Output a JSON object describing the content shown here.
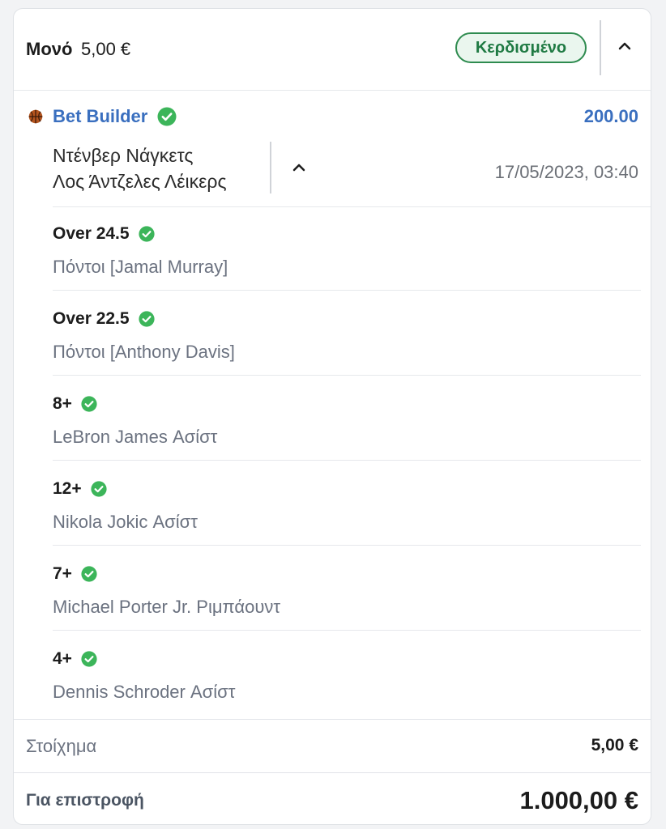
{
  "header": {
    "bet_type": "Μονό",
    "stake": "5,00 €",
    "status": "Κερδισμένο"
  },
  "selection": {
    "title": "Bet Builder",
    "odds": "200.00",
    "team_home": "Ντένβερ Νάγκετς",
    "team_away": "Λος Άντζελες  Λέικερς",
    "date": "17/05/2023, 03:40",
    "sport_icon": "basketball-icon"
  },
  "legs": [
    {
      "line": "Over 24.5",
      "market": "Πόντοι [Jamal Murray]"
    },
    {
      "line": "Over 22.5",
      "market": "Πόντοι [Anthony Davis]"
    },
    {
      "line": "8+",
      "market": "LeBron James Ασίστ"
    },
    {
      "line": "12+",
      "market": "Nikola Jokic Ασίστ"
    },
    {
      "line": "7+",
      "market": "Michael Porter Jr. Ριμπάουντ"
    },
    {
      "line": "4+",
      "market": "Dennis Schroder Ασίστ"
    }
  ],
  "footer": {
    "stake_label": "Στοίχημα",
    "stake_value": "5,00 €",
    "return_label": "Για επιστροφή",
    "return_value": "1.000,00 €"
  },
  "colors": {
    "accent_blue": "#3a6fbf",
    "won_green": "#2e8b4f",
    "check_green": "#3cb55a"
  }
}
